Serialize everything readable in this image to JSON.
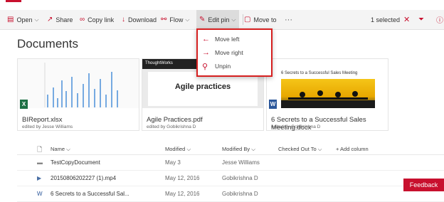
{
  "toolbar": {
    "open": "Open",
    "share": "Share",
    "copy_link": "Copy link",
    "download": "Download",
    "flow": "Flow",
    "edit_pin": "Edit pin",
    "move_to": "Move to",
    "more": "···",
    "selected": "1 selected"
  },
  "dropdown": {
    "items": [
      "Move left",
      "Move right",
      "Unpin"
    ]
  },
  "page": {
    "title": "Documents"
  },
  "cards": [
    {
      "name": "BIReport.xlsx",
      "sub": "edited by Jesse Williams",
      "badge": "X",
      "badge_color": "#1e7145"
    },
    {
      "name": "Agile Practices.pdf",
      "sub": "edited by Gobikrishna D",
      "thumb_brand": "ThoughtWorks",
      "thumb_title": "Agile practices"
    },
    {
      "name": "6 Secrets to a Successful Sales Meeting.docx",
      "sub": "edited by Gobikrishna D",
      "badge": "W",
      "badge_color": "#2b579a",
      "thumb_title": "6 Secrets to a Successful Sales Meeting"
    }
  ],
  "list": {
    "headers": {
      "name": "Name",
      "modified": "Modified",
      "modified_by": "Modified By",
      "checked_out_to": "Checked Out To",
      "add_column": "+ Add column"
    },
    "rows": [
      {
        "name": "TestCopyDocument",
        "modified": "May 3",
        "modified_by": "Jesse Williams"
      },
      {
        "name": "20150806202227 (1).mp4",
        "modified": "May 12, 2016",
        "modified_by": "Gobikrishna D"
      },
      {
        "name": "6 Secrets to a Successful Sal...",
        "modified": "May 12, 2016",
        "modified_by": "Gobikrishna D"
      }
    ]
  },
  "feedback": "Feedback",
  "colors": {
    "accent": "#c8102e",
    "highlight": "#d62020"
  }
}
